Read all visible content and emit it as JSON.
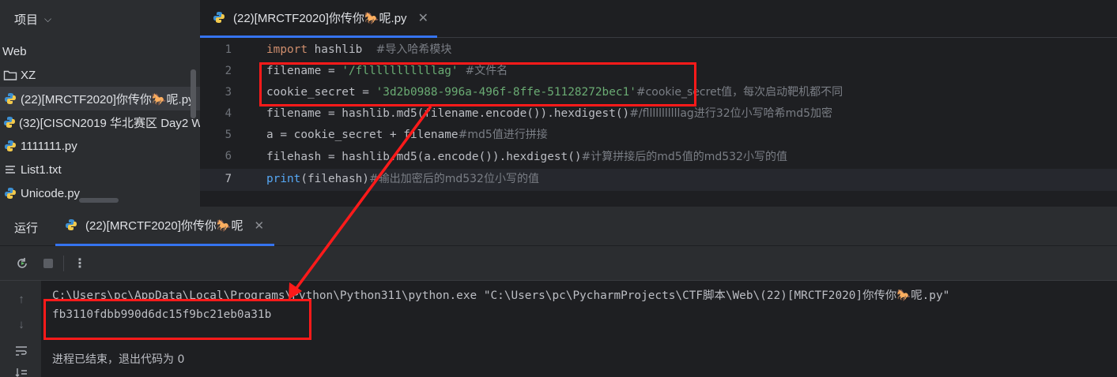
{
  "project": {
    "title": "项目",
    "items": [
      {
        "label": "Web",
        "icon": "none"
      },
      {
        "label": "XZ",
        "icon": "folder-icon"
      },
      {
        "label": "(22)[MRCTF2020]你传你🐎呢.py",
        "icon": "python-file-icon",
        "selected": true
      },
      {
        "label": "(32)[CISCN2019 华北赛区 Day2 W",
        "icon": "python-file-icon"
      },
      {
        "label": "1111111.py",
        "icon": "python-file-icon"
      },
      {
        "label": "List1.txt",
        "icon": "text-file-icon"
      },
      {
        "label": "Unicode.py",
        "icon": "python-file-icon"
      }
    ]
  },
  "editor": {
    "tab_label": "(22)[MRCTF2020]你传你🐎呢.py",
    "line_numbers": [
      "1",
      "2",
      "3",
      "4",
      "5",
      "6",
      "7"
    ],
    "lines": {
      "l1_import": "import",
      "l1_mod": " hashlib  ",
      "l1_cmt": "#导入哈希模块",
      "l2_code": "filename = ",
      "l2_str": "'/flllllllllllag'",
      "l2_cmt": "  #文件名",
      "l3_code": "cookie_secret = ",
      "l3_str": "'3d2b0988-996a-496f-8ffe-51128272bec1'",
      "l3_cmt": "#cookie_secret值，每次启动靶机都不同",
      "l4_code": "filename = hashlib.md5(filename.encode()).hexdigest()",
      "l4_cmt": "#/flllllllllllag进行32位小写哈希md5加密",
      "l5_code": "a = cookie_secret + filename",
      "l5_cmt": "#md5值进行拼接",
      "l6_code": "filehash = hashlib.md5(a.encode()).hexdigest()",
      "l6_cmt": "#计算拼接后的md5值的md532小写的值",
      "l7_fn": "print",
      "l7_code": "(filehash)",
      "l7_cmt": "#输出加密后的md532位小写的值"
    }
  },
  "run": {
    "title": "运行",
    "tab_label": "(22)[MRCTF2020]你传你🐎呢",
    "console": {
      "command": "C:\\Users\\pc\\AppData\\Local\\Programs\\Python\\Python311\\python.exe \"C:\\Users\\pc\\PycharmProjects\\CTF脚本\\Web\\(22)[MRCTF2020]你传你🐎呢.py\"",
      "output": "fb3110fdbb990d6dc15f9bc21eb0a31b",
      "exit_message": "进程已结束，退出代码为 0"
    }
  },
  "colors": {
    "annotation": "#ff1a1a",
    "accent": "#3574f0"
  }
}
